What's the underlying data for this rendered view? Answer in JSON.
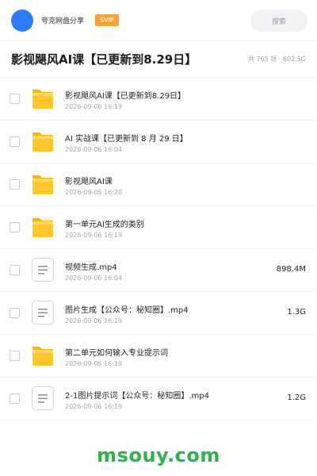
{
  "header": {
    "account_name": "夸克网盘分享",
    "vip_badge": "SVIP",
    "search_placeholder": "搜索"
  },
  "folder": {
    "title": "影视飓风AI课【已更新到8.29日】",
    "meta": "共 765 项 · 602.5G"
  },
  "files": [
    {
      "name": "影视飓风AI课【已更新到8.29日】",
      "date": "2026-09-06 16:19",
      "type": "folder",
      "size": ""
    },
    {
      "name": "AI 实战课【已更新到 8 月 29 日】",
      "date": "2026-09-06 16:04",
      "type": "folder",
      "size": ""
    },
    {
      "name": "影视飓风AI课",
      "date": "2026-09-06 16:20",
      "type": "folder",
      "size": ""
    },
    {
      "name": "第一单元AI生成的类别",
      "date": "2026-09-06 16:19",
      "type": "folder",
      "size": ""
    },
    {
      "name": "视频生成.mp4",
      "date": "2026-09-06 16:04",
      "type": "file",
      "size": "898.4M"
    },
    {
      "name": "图片生成【公众号：秘知圈】.mp4",
      "date": "2026-09-06 16:19",
      "type": "file",
      "size": "1.3G"
    },
    {
      "name": "第二单元如何输入专业提示词",
      "date": "2026-09-06 16:19",
      "type": "folder",
      "size": ""
    },
    {
      "name": "2-1图片提示词【公众号：秘知圈】.mp4",
      "date": "2026-09-06 16:19",
      "type": "file",
      "size": "1.2G"
    }
  ],
  "watermark": "msouy.com",
  "colors": {
    "avatar": "#2f7bff",
    "vip": "#f7a23a",
    "folder": "#ffc72c",
    "watermark": "#2db34a"
  }
}
